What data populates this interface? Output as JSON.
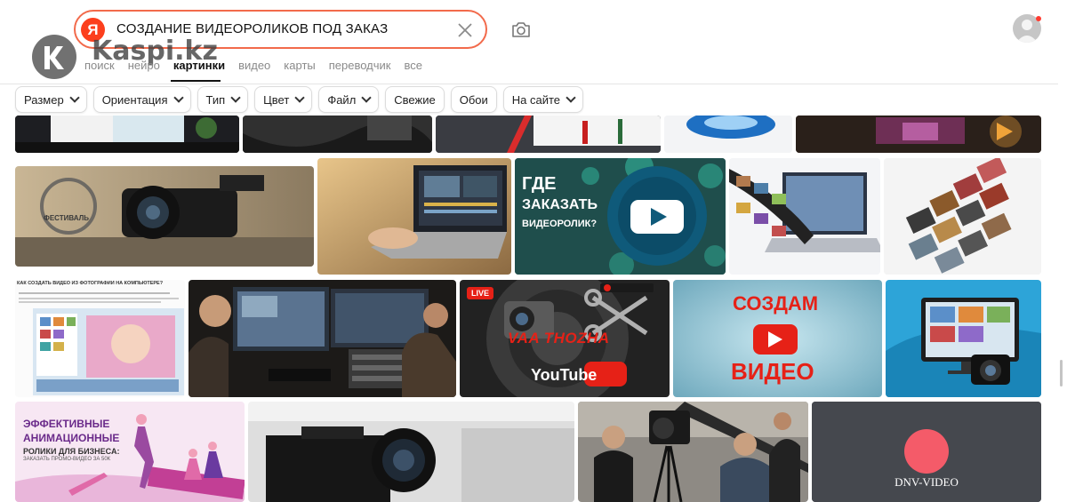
{
  "search": {
    "logo_letter": "Я",
    "query": "СОЗДАНИЕ ВИДЕОРОЛИКОВ ПОД ЗАКАЗ"
  },
  "icons": {
    "clear": "close-icon",
    "camera": "camera-icon",
    "avatar": "user-avatar"
  },
  "watermark": {
    "text": "Kaspi.kz"
  },
  "nav": {
    "items": [
      "поиск",
      "нейро",
      "картинки",
      "видео",
      "карты",
      "переводчик",
      "все"
    ],
    "active": "картинки"
  },
  "filters": [
    {
      "label": "Размер",
      "dropdown": true
    },
    {
      "label": "Ориентация",
      "dropdown": true
    },
    {
      "label": "Тип",
      "dropdown": true
    },
    {
      "label": "Цвет",
      "dropdown": true
    },
    {
      "label": "Файл",
      "dropdown": true
    },
    {
      "label": "Свежие",
      "dropdown": false
    },
    {
      "label": "Обои",
      "dropdown": false
    },
    {
      "label": "На сайте",
      "dropdown": true
    }
  ],
  "images": {
    "row2_1_badge": "ФЕСТИВАЛЬ",
    "row2_3_line1": "ГДЕ",
    "row2_3_line2": "ЗАКАЗАТЬ",
    "row2_3_line3": "ВИДЕОРОЛИК?",
    "row3_1_title": "КАК СОЗДАТЬ ВИДЕО ИЗ ФОТОГРАФИЙ НА КОМПЬЮТЕРЕ?",
    "row3_3_live": "LIVE",
    "row3_3_name": "VAA THOZHA",
    "row3_3_brand": "YouTube",
    "row3_4_line1": "СОЗДАМ",
    "row3_4_line2": "ВИДЕО",
    "row4_1_line1": "ЭФФЕКТИВНЫЕ",
    "row4_1_line2": "АНИМАЦИОННЫЕ",
    "row4_1_line3": "РОЛИКИ ДЛЯ БИЗНЕСА:",
    "row4_1_line4": "ЗАКАЗАТЬ ПРОМО-ВИДЕО ЗА 50К",
    "row4_4_caption": "DNV-VIDEO"
  },
  "colors": {
    "accent": "#fc3f1d",
    "search_border": "#f26a4b",
    "youtube_red": "#e62117",
    "teal": "#1f4e4c",
    "dnv_bg": "#45484e",
    "dnv_circle": "#f45b69"
  }
}
